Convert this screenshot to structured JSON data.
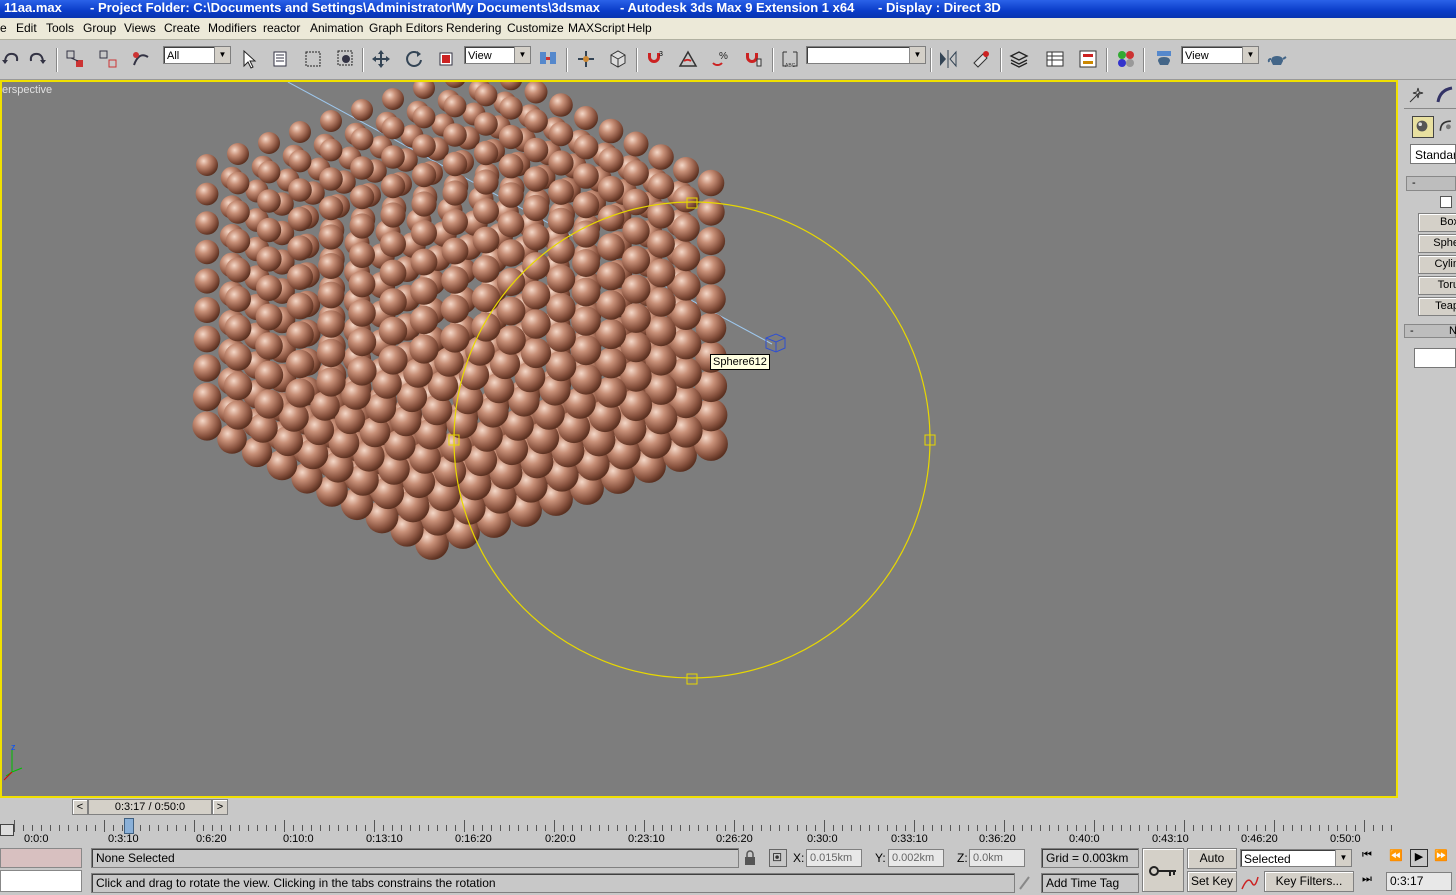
{
  "titlebar": {
    "file": "11aa.max",
    "project": "- Project Folder: C:\\Documents and Settings\\Administrator\\My Documents\\3dsmax",
    "app": "- Autodesk 3ds Max 9 Extension 1 x64",
    "display": "- Display : Direct 3D"
  },
  "menu": [
    "e",
    "Edit",
    "Tools",
    "Group",
    "Views",
    "Create",
    "Modifiers",
    "reactor",
    "Animation",
    "Graph Editors",
    "Rendering",
    "Customize",
    "MAXScript",
    "Help"
  ],
  "toolbar": {
    "selection_filter": "All",
    "ref_coord": "View",
    "named_selection": "",
    "render_view": "View"
  },
  "viewport": {
    "label": "erspective",
    "tooltip": "Sphere612",
    "axis_z": "z",
    "sphere_color": "#b07860",
    "background": "#7d7d7d"
  },
  "command_panel": {
    "dropdown": "Standarc",
    "rollout1_label": "-",
    "buttons": [
      "Box",
      "Sphe",
      "Cylin",
      "Toru",
      "Teap"
    ],
    "rollout2_label": "-",
    "rollout2_letter": "N"
  },
  "time": {
    "slider": "0:3:17 / 0:50:0",
    "prev": "<",
    "next": ">",
    "ticks": [
      "0:0:0",
      "0:3:10",
      "0:6:20",
      "0:10:0",
      "0:13:10",
      "0:16:20",
      "0:20:0",
      "0:23:10",
      "0:26:20",
      "0:30:0",
      "0:33:10",
      "0:36:20",
      "0:40:0",
      "0:43:10",
      "0:46:20",
      "0:50:0"
    ]
  },
  "status": {
    "selection": "None Selected",
    "prompt": "Click and drag to rotate the view.  Clicking in the tabs constrains the rotation",
    "x_label": "X:",
    "x_value": "0.015km",
    "y_label": "Y:",
    "y_value": "0.002km",
    "z_label": "Z:",
    "z_value": "0.0km",
    "grid": "Grid = 0.003km",
    "add_time_tag": "Add Time Tag",
    "auto_key": "Auto Key",
    "set_key": "Set Key",
    "key_mode": "Selected",
    "key_filters": "Key Filters...",
    "current_time": "0:3:17"
  }
}
